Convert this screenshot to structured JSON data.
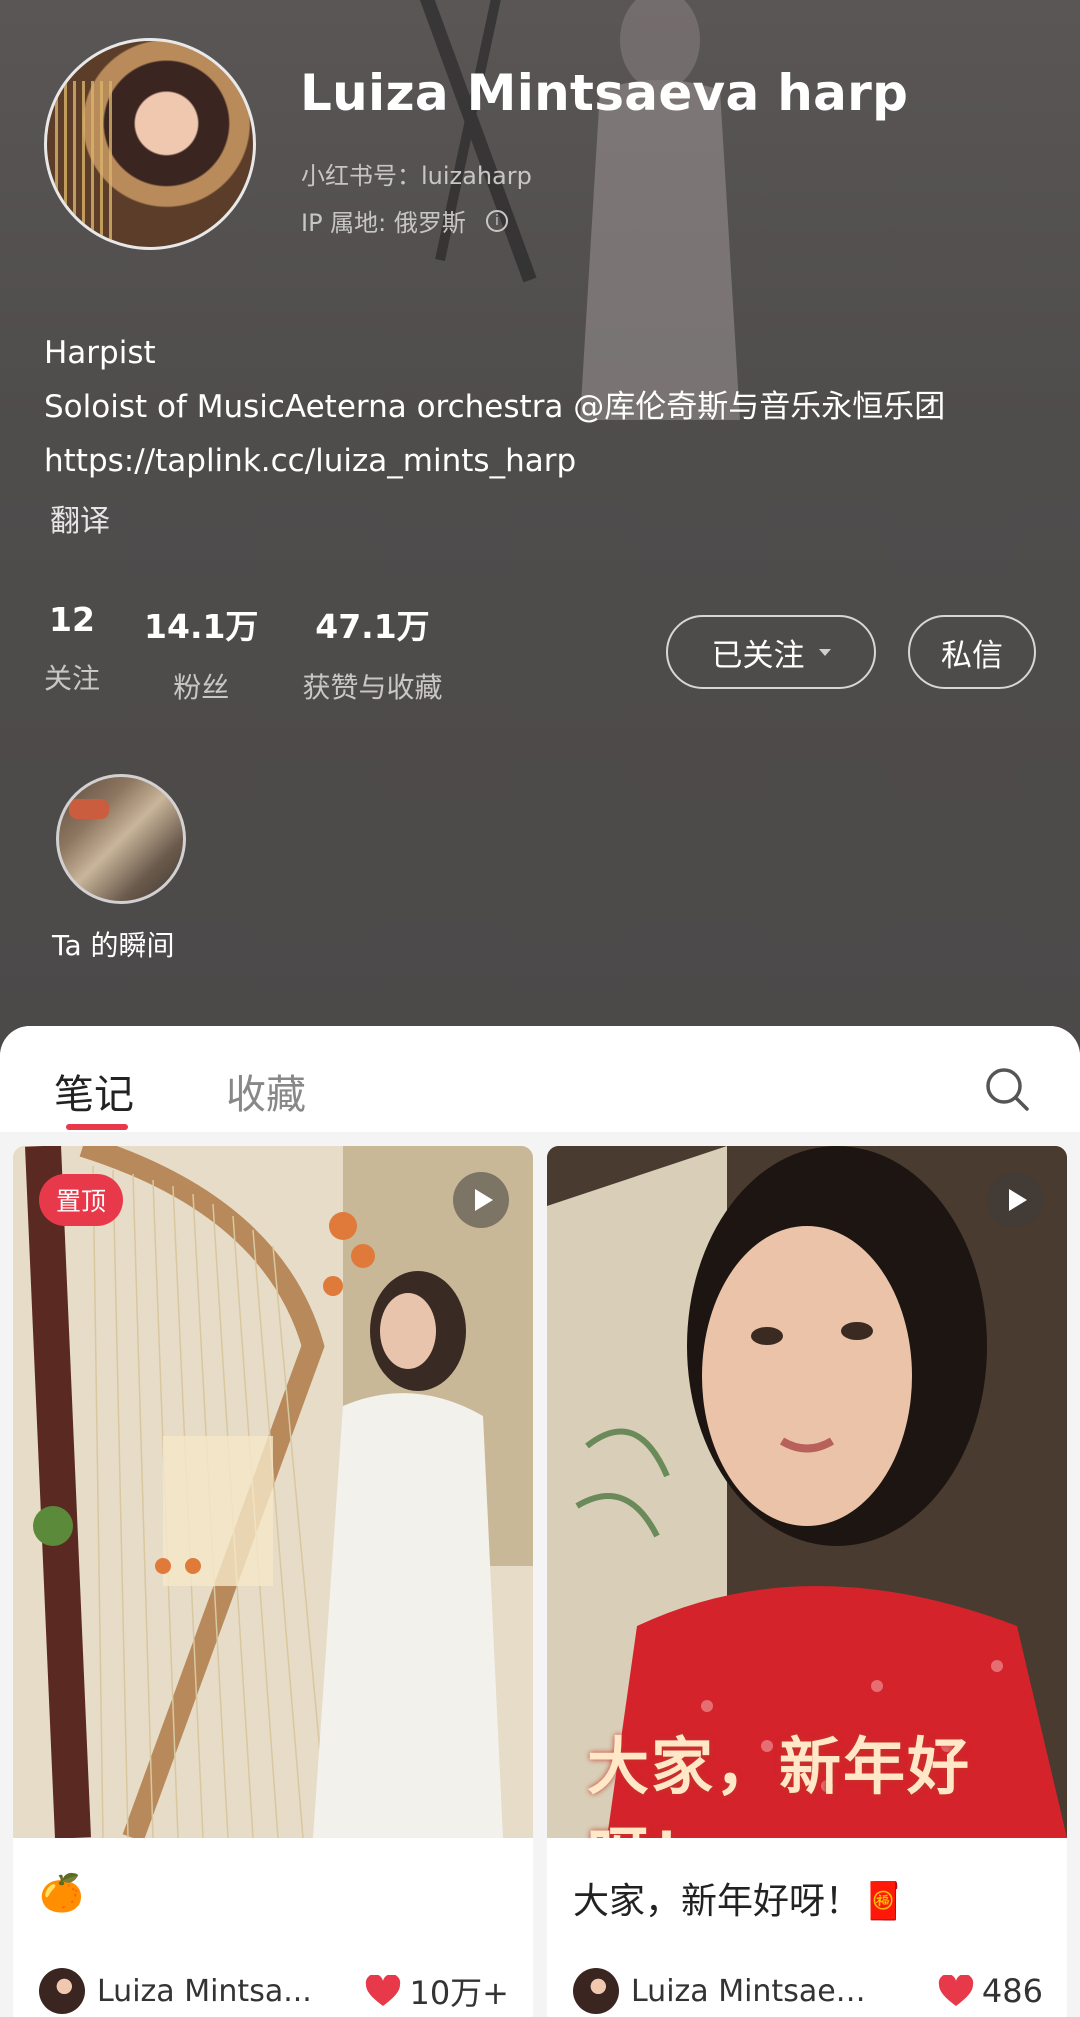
{
  "profile": {
    "name": "Luiza Mintsaeva harp",
    "xhs_id": "小红书号：luizaharp",
    "ip_location": "IP 属地: 俄罗斯",
    "bio": [
      "Harpist",
      "Soloist of MusicAeterna orchestra @库伦奇斯与音乐永恒乐团",
      "https://taplink.cc/luiza_mints_harp"
    ],
    "translate_label": "翻译"
  },
  "stats": [
    {
      "value": "12",
      "label": "关注"
    },
    {
      "value": "14.1万",
      "label": "粉丝"
    },
    {
      "value": "47.1万",
      "label": "获赞与收藏"
    }
  ],
  "actions": {
    "follow_label": "已关注",
    "message_label": "私信"
  },
  "moments": {
    "label": "Ta 的瞬间"
  },
  "tabs": [
    {
      "label": "笔记",
      "active": true
    },
    {
      "label": "收藏",
      "active": false
    }
  ],
  "notes": [
    {
      "pinned_label": "置顶",
      "title": "🍊",
      "author": "Luiza Mintsa...",
      "likes": "10万+"
    },
    {
      "overlay_text": "大家，新年好呀！",
      "title": "大家，新年好呀！🧧",
      "author": "Luiza Mintsaev...",
      "likes": "486"
    }
  ],
  "colors": {
    "accent": "#e8394a",
    "header_bg": "#4f4c4c"
  }
}
